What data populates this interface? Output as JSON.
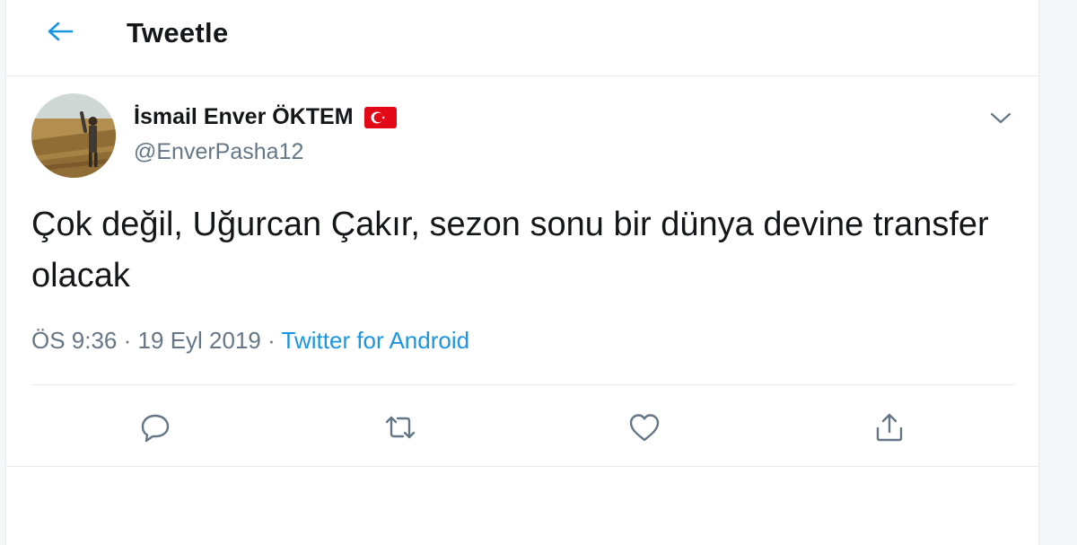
{
  "header": {
    "title": "Tweetle",
    "back_icon": "arrow-left-icon"
  },
  "tweet": {
    "author": {
      "display_name": "İsmail Enver ÖKTEM",
      "handle": "@EnverPasha12",
      "flag_icon": "turkey-flag-icon",
      "avatar_icon": "avatar-photo"
    },
    "text": "Çok değil, Uğurcan Çakır, sezon sonu bir dünya devine transfer olacak",
    "time": "ÖS 9:36",
    "separator": "·",
    "date": "19 Eyl 2019",
    "source": "Twitter for Android",
    "menu_icon": "chevron-down-icon"
  },
  "actions": [
    {
      "icon": "reply-icon"
    },
    {
      "icon": "retweet-icon"
    },
    {
      "icon": "like-icon"
    },
    {
      "icon": "share-icon"
    }
  ],
  "colors": {
    "accent": "#1b95e0",
    "text": "#14171a",
    "muted": "#657786",
    "border": "#e6ecf0",
    "flag_red": "#e30a17"
  }
}
